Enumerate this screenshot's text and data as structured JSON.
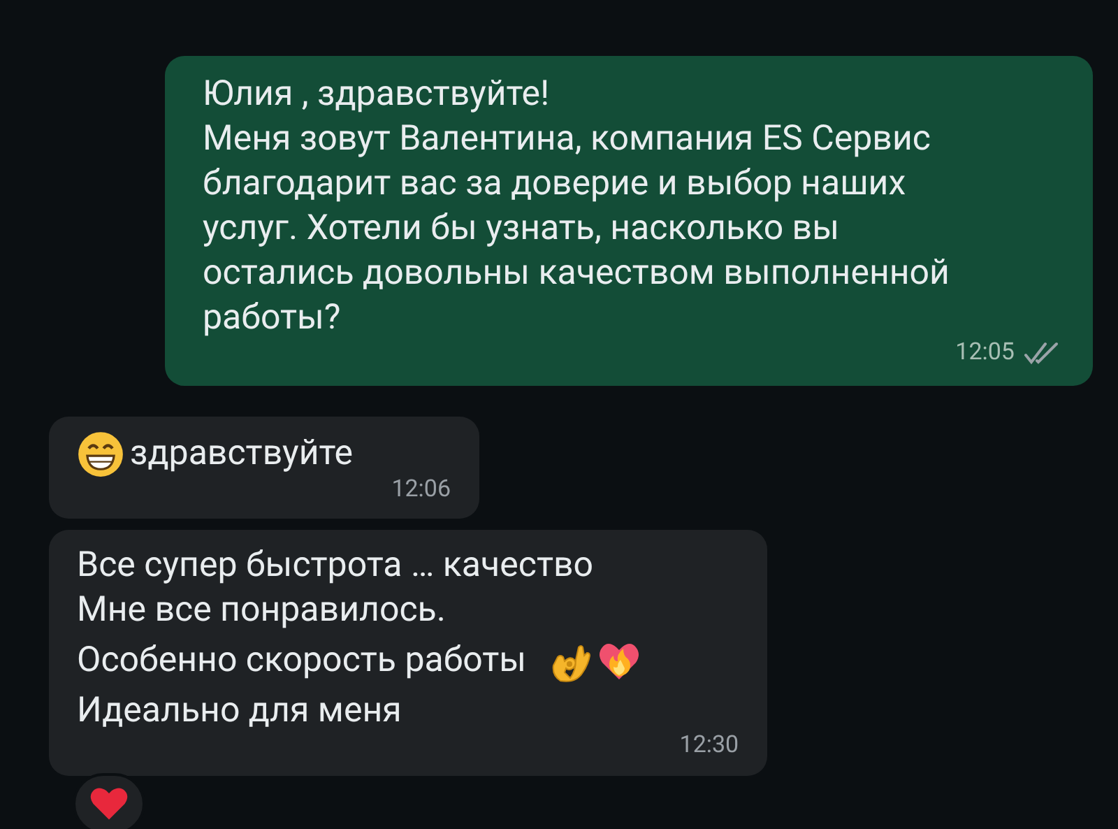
{
  "messages": [
    {
      "kind": "outgoing",
      "lines": [
        {
          "text": "Юлия , здравствуйте!"
        },
        {
          "text": "Меня зовут Валентина, компания ES Сервис"
        },
        {
          "text": "благодарит вас за доверие и выбор наших"
        },
        {
          "text": "услуг. Хотели бы узнать, насколько вы"
        },
        {
          "text": "остались довольны качеством выполненной"
        },
        {
          "text": "работы?"
        }
      ],
      "time": "12:05",
      "read": false
    },
    {
      "kind": "incoming",
      "lines": [
        {
          "text": "здравствуйте",
          "lead_icons": [
            {
              "kind": "grin"
            }
          ]
        }
      ],
      "time": "12:06"
    },
    {
      "kind": "incoming",
      "lines": [
        {
          "text": "Все супер быстрота … качество"
        },
        {
          "text": "Мне все понравилось."
        },
        {
          "text": "Особенно скорость работы",
          "trail_icons": [
            {
              "kind": "okhand"
            },
            {
              "kind": "fireheart"
            }
          ]
        },
        {
          "text": "Идеально для меня"
        }
      ],
      "time": "12:30",
      "reactions": [
        {
          "kind": "heart"
        }
      ]
    }
  ]
}
